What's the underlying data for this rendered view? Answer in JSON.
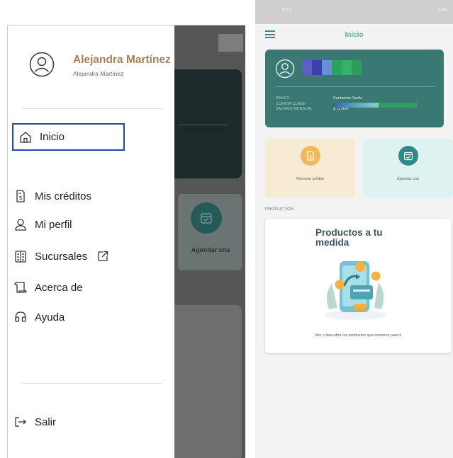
{
  "drawer": {
    "user_name": "Alejandra Martínez",
    "user_subtitle": "Alejandra Martínez",
    "items": [
      {
        "label": "Inicio",
        "icon": "home-icon",
        "active": true
      },
      {
        "label": "Mis créditos",
        "icon": "credit-document-icon"
      },
      {
        "label": "Mi perfil",
        "icon": "person-icon"
      },
      {
        "label": "Sucursales",
        "icon": "building-icon",
        "external": true
      },
      {
        "label": "Acerca de",
        "icon": "scroll-icon"
      },
      {
        "label": "Ayuda",
        "icon": "headset-icon"
      }
    ],
    "logout_label": "Salir",
    "accent_color": "#a78152",
    "highlight_border_color": "#1f4aa6"
  },
  "background_screen": {
    "tile_label": "Agendar cita"
  },
  "phone": {
    "status_time": "3:15",
    "status_right": "24%",
    "app_title": "Inicio",
    "account": {
      "labels": [
        "BANCO",
        "CUENTA CLABE",
        "SALARIO MENSUAL"
      ],
      "bank": "Santander Serfin",
      "salary": "$ 12,400"
    },
    "tiles": [
      {
        "label": "Renovar crédito",
        "icon": "renew-document-icon",
        "color": "#f7ebd4"
      },
      {
        "label": "Agendar cita",
        "icon": "calendar-icon",
        "color": "#dff2f2"
      }
    ],
    "section_label": "PRODUCTOS",
    "product": {
      "title": "Productos a tu medida",
      "subtitle": "Ven y descubre los productos que tenemos para ti"
    },
    "brand_color": "#3a7873"
  }
}
